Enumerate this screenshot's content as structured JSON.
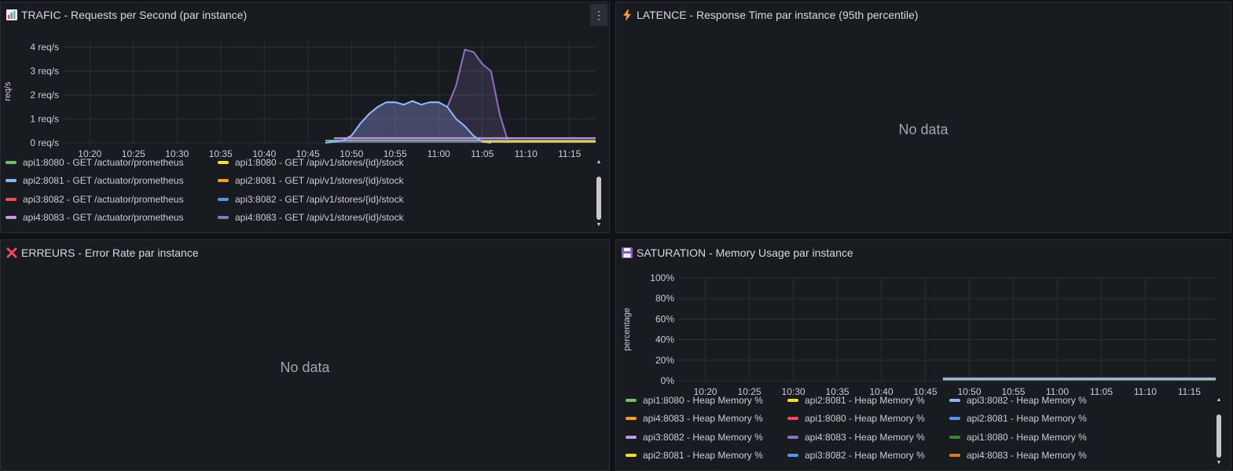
{
  "panels": {
    "traffic": {
      "icon": "chart-icon",
      "title": "TRAFIC - Requests per Second (par instance)",
      "menu_label": "⋮",
      "chart_data": {
        "type": "area",
        "title": "TRAFIC - Requests per Second (par instance)",
        "ylabel": "req/s",
        "ylim": [
          0,
          4.3
        ],
        "yticks": [
          "0 req/s",
          "1 req/s",
          "2 req/s",
          "3 req/s",
          "4 req/s"
        ],
        "yticks_values": [
          0,
          1,
          2,
          3,
          4
        ],
        "xticks": [
          "10:20",
          "10:25",
          "10:30",
          "10:35",
          "10:40",
          "10:45",
          "10:50",
          "10:55",
          "11:00",
          "11:05",
          "11:10",
          "11:15"
        ],
        "x_range": [
          "10:17",
          "11:18"
        ],
        "grid": true,
        "series": [
          {
            "name": "api1:8080 - GET /actuator/prometheus",
            "color": "#73bf69",
            "x": [
              "10:47",
              "11:18"
            ],
            "values": [
              0.1,
              0.1
            ]
          },
          {
            "name": "api4:8083 - GET /api/v1/stores/{id}/stock",
            "color": "#8f72c3",
            "x": [
              "10:47",
              "10:48",
              "10:49",
              "10:50",
              "10:51",
              "10:52",
              "10:53",
              "10:54",
              "10:55",
              "10:56",
              "10:57",
              "10:58",
              "10:59",
              "11:00",
              "11:01",
              "11:02",
              "11:03",
              "11:04",
              "11:05",
              "11:06",
              "11:07",
              "11:08"
            ],
            "values": [
              0,
              0.05,
              0.1,
              0.3,
              0.8,
              1.2,
              1.5,
              1.7,
              1.7,
              1.6,
              1.75,
              1.6,
              1.7,
              1.7,
              1.5,
              2.4,
              3.9,
              3.8,
              3.3,
              3.0,
              1.2,
              0
            ]
          },
          {
            "name": "api2:8081 - GET /actuator/prometheus",
            "color": "#8ab8ff",
            "x": [
              "10:47",
              "10:48",
              "10:49",
              "10:50",
              "10:51",
              "10:52",
              "10:53",
              "10:54",
              "10:55",
              "10:56",
              "10:57",
              "10:58",
              "10:59",
              "11:00",
              "11:01",
              "11:02",
              "11:03",
              "11:04",
              "11:05",
              "11:06"
            ],
            "values": [
              0,
              0.05,
              0.1,
              0.3,
              0.8,
              1.2,
              1.5,
              1.7,
              1.7,
              1.6,
              1.75,
              1.6,
              1.7,
              1.7,
              1.5,
              1.0,
              0.7,
              0.3,
              0.05,
              0
            ]
          },
          {
            "name": "api1:8080 - GET /api/v1/stores/{id}/stock",
            "color": "#fade2a",
            "x": [
              "11:05",
              "11:18"
            ],
            "values": [
              0.05,
              0.05
            ]
          },
          {
            "name": "api4:8083 - GET /actuator/prometheus",
            "color": "#ca95e5",
            "x": [
              "10:48",
              "11:18"
            ],
            "values": [
              0.2,
              0.2
            ]
          }
        ]
      },
      "legend": [
        [
          {
            "label": "api1:8080 - GET /actuator/prometheus",
            "color": "#73bf69"
          },
          {
            "label": "api1:8080 - GET /api/v1/stores/{id}/stock",
            "color": "#fade2a"
          }
        ],
        [
          {
            "label": "api2:8081 - GET /actuator/prometheus",
            "color": "#8ab8ff"
          },
          {
            "label": "api2:8081 - GET /api/v1/stores/{id}/stock",
            "color": "#ff9830"
          }
        ],
        [
          {
            "label": "api3:8082 - GET /actuator/prometheus",
            "color": "#f2495c"
          },
          {
            "label": "api3:8082 - GET /api/v1/stores/{id}/stock",
            "color": "#5794f2"
          }
        ],
        [
          {
            "label": "api4:8083 - GET /actuator/prometheus",
            "color": "#ca95e5"
          },
          {
            "label": "api4:8083 - GET /api/v1/stores/{id}/stock",
            "color": "#8f72c3"
          }
        ]
      ]
    },
    "latency": {
      "icon": "lightning-icon",
      "title": "LATENCE - Response Time par instance (95th percentile)",
      "nodata": "No data"
    },
    "errors": {
      "icon": "cross-icon",
      "title": "ERREURS - Error Rate par instance",
      "nodata": "No data"
    },
    "saturation": {
      "icon": "floppy-icon",
      "title": "SATURATION - Memory Usage par instance",
      "chart_data": {
        "type": "line",
        "title": "SATURATION - Memory Usage par instance",
        "ylabel": "percentage",
        "ylim": [
          0,
          100
        ],
        "yticks": [
          "0%",
          "20%",
          "40%",
          "60%",
          "80%",
          "100%"
        ],
        "yticks_values": [
          0,
          20,
          40,
          60,
          80,
          100
        ],
        "xticks": [
          "10:20",
          "10:25",
          "10:30",
          "10:35",
          "10:40",
          "10:45",
          "10:50",
          "10:55",
          "11:00",
          "11:05",
          "11:10",
          "11:15"
        ],
        "x_range": [
          "10:17",
          "11:18"
        ],
        "grid": true,
        "series": [
          {
            "name": "api4:8083 - Heap Memory %",
            "color": "#8f72c3",
            "x": [
              "10:47",
              "11:18"
            ],
            "values": [
              2.5,
              2.5
            ]
          },
          {
            "name": "api2:8081 - Heap Memory %",
            "color": "#fade2a",
            "x": [
              "10:47",
              "11:18"
            ],
            "values": [
              1.5,
              1.5
            ]
          },
          {
            "name": "api3:8082 - Heap Memory %",
            "color": "#8ab8ff",
            "x": [
              "10:47",
              "11:18"
            ],
            "values": [
              2.0,
              2.0
            ]
          }
        ]
      },
      "legend": [
        [
          {
            "label": "api1:8080 - Heap Memory %",
            "color": "#73bf69"
          },
          {
            "label": "api2:8081 - Heap Memory %",
            "color": "#fade2a"
          },
          {
            "label": "api3:8082 - Heap Memory %",
            "color": "#8ab8ff"
          }
        ],
        [
          {
            "label": "api4:8083 - Heap Memory %",
            "color": "#ff9830"
          },
          {
            "label": "api1:8080 - Heap Memory %",
            "color": "#f2495c"
          },
          {
            "label": "api2:8081 - Heap Memory %",
            "color": "#5794f2"
          }
        ],
        [
          {
            "label": "api3:8082 - Heap Memory %",
            "color": "#ca95e5"
          },
          {
            "label": "api4:8083 - Heap Memory %",
            "color": "#8f72c3"
          },
          {
            "label": "api1:8080 - Heap Memory %",
            "color": "#37872d"
          }
        ],
        [
          {
            "label": "api2:8081 - Heap Memory %",
            "color": "#fade2a"
          },
          {
            "label": "api3:8082 - Heap Memory %",
            "color": "#5794f2"
          },
          {
            "label": "api4:8083 - Heap Memory %",
            "color": "#e0752d"
          }
        ]
      ]
    }
  }
}
